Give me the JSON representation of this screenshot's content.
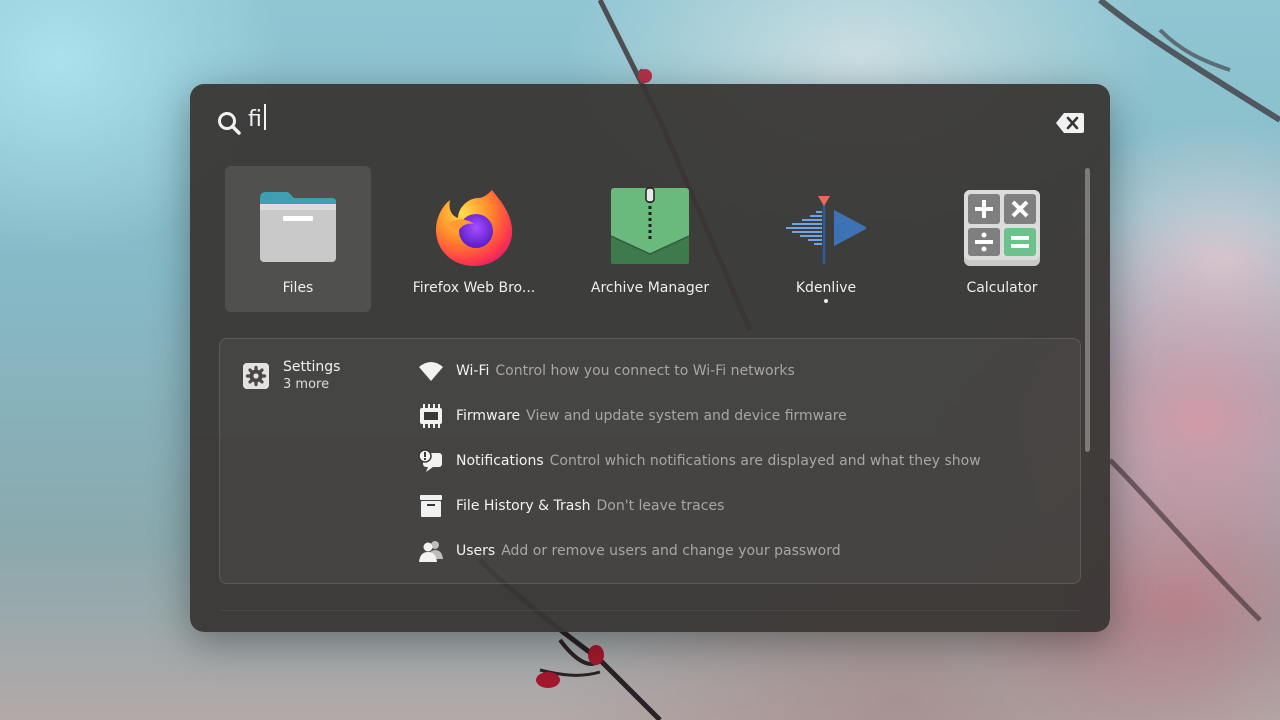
{
  "search": {
    "query": "fi"
  },
  "apps": [
    {
      "name": "Files",
      "icon": "folder-icon",
      "selected": true
    },
    {
      "name": "Firefox Web Bro...",
      "icon": "firefox-icon"
    },
    {
      "name": "Archive Manager",
      "icon": "archive-icon"
    },
    {
      "name": "Kdenlive",
      "icon": "kdenlive-icon",
      "running": true
    },
    {
      "name": "Calculator",
      "icon": "calculator-icon"
    }
  ],
  "settings": {
    "provider": "Settings",
    "more": "3 more",
    "results": [
      {
        "title": "Wi-Fi",
        "description": "Control how you connect to Wi-Fi networks",
        "icon": "wifi-icon"
      },
      {
        "title": "Firmware",
        "description": "View and update system and device firmware",
        "icon": "firmware-chip-icon"
      },
      {
        "title": "Notifications",
        "description": "Control which notifications are displayed and what they show",
        "icon": "notification-bubble-icon"
      },
      {
        "title": "File History & Trash",
        "description": "Don't leave traces",
        "icon": "file-box-icon"
      },
      {
        "title": "Users",
        "description": "Add or remove users and change your password",
        "icon": "users-icon"
      }
    ]
  }
}
